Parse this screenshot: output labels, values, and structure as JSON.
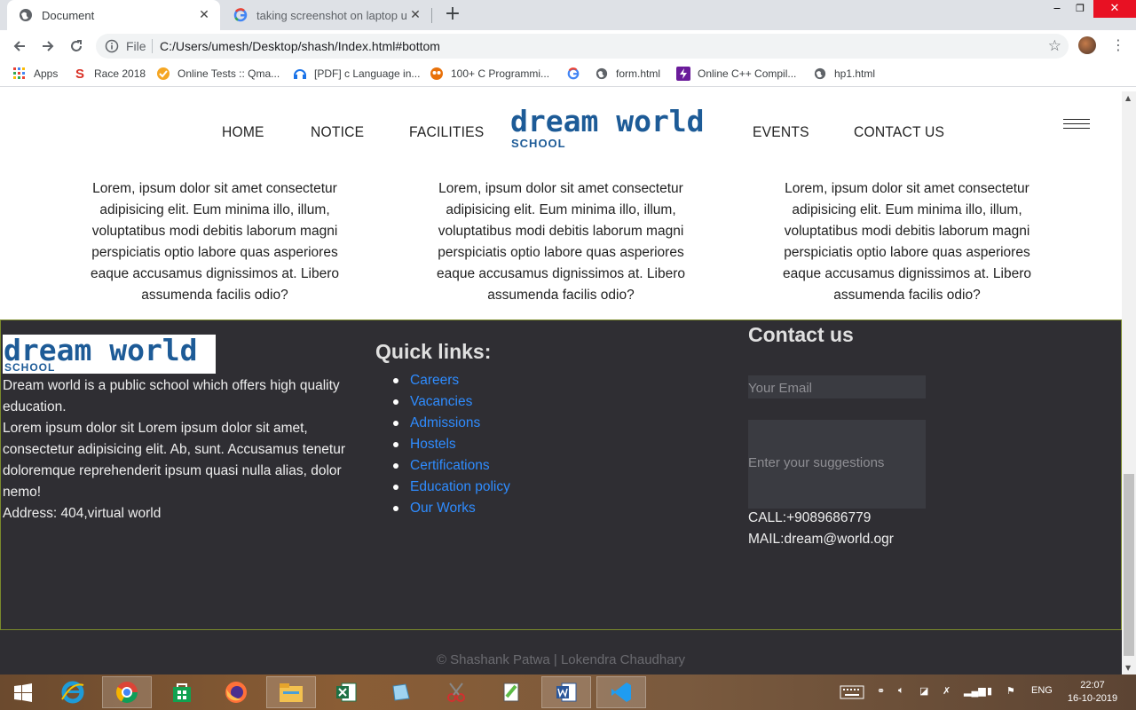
{
  "browser": {
    "tabs": [
      {
        "title": "Document",
        "active": true
      },
      {
        "title": "taking screenshot on laptop usin",
        "active": false
      }
    ],
    "window_controls": {
      "minimize": "‒",
      "maximize": "❐",
      "close": "✕"
    },
    "omnibox": {
      "scheme_label": "File",
      "url": "C:/Users/umesh/Desktop/shash/Index.html#bottom"
    },
    "bookmarks": [
      "Apps",
      "Race 2018",
      "Online Tests :: Qma...",
      "[PDF] c Language in...",
      "100+ C Programmi...",
      "form.html",
      "Online C++ Compil...",
      "hp1.html"
    ]
  },
  "site": {
    "nav_left": [
      "HOME",
      "NOTICE",
      "FACILITIES"
    ],
    "nav_right": [
      "EVENTS",
      "CONTACT US"
    ],
    "logo": {
      "title": "dream world",
      "subtitle": "SCHOOL"
    },
    "cards": [
      "Lorem, ipsum dolor sit amet consectetur adipisicing elit. Eum minima illo, illum, voluptatibus modi debitis laborum magni perspiciatis optio labore quas asperiores eaque accusamus dignissimos at. Libero assumenda facilis odio?",
      "Lorem, ipsum dolor sit amet consectetur adipisicing elit. Eum minima illo, illum, voluptatibus modi debitis laborum magni perspiciatis optio labore quas asperiores eaque accusamus dignissimos at. Libero assumenda facilis odio?",
      "Lorem, ipsum dolor sit amet consectetur adipisicing elit. Eum minima illo, illum, voluptatibus modi debitis laborum magni perspiciatis optio labore quas asperiores eaque accusamus dignissimos at. Libero assumenda facilis odio?"
    ],
    "footer": {
      "about": {
        "line1": "Dream world is a public school which offers high quality education.",
        "line2": "Lorem ipsum dolor sit Lorem ipsum dolor sit amet, consectetur adipisicing elit. Ab, sunt. Accusamus tenetur doloremque reprehenderit ipsum quasi nulla alias, dolor nemo!",
        "address": "Address: 404,virtual world"
      },
      "quick_links_title": "Quick links:",
      "quick_links": [
        "Careers",
        "Vacancies",
        "Admissions",
        "Hostels",
        "Certifications",
        "Education policy",
        "Our Works"
      ],
      "contact_title": "Contact us",
      "email_placeholder": "Your Email",
      "suggestions_placeholder": "Enter your suggestions",
      "call": "CALL:+9089686779",
      "mail": "MAIL:dream@world.ogr"
    },
    "copyright": "© Shashank Patwa | Lokendra Chaudhary"
  },
  "taskbar": {
    "language": "ENG",
    "time": "22:07",
    "date": "16-10-2019"
  },
  "colors": {
    "logo_blue": "#1d5b97",
    "footer_bg": "#2f2e33",
    "link_blue": "#2f8cff"
  }
}
